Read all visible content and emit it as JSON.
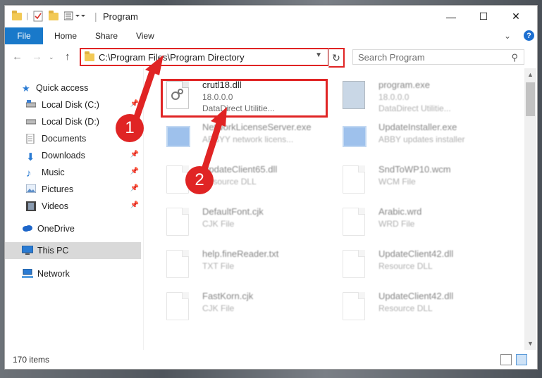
{
  "window": {
    "title": "Program",
    "controls": {
      "minimize": "—",
      "maximize": "☐",
      "close": "✕"
    }
  },
  "ribbon": {
    "file_tab": "File",
    "tabs": [
      "Home",
      "Share",
      "View"
    ],
    "collapse": "⌄",
    "help": "?"
  },
  "address": {
    "path": "C:\\Program Files\\Program Directory",
    "search_placeholder": "Search Program"
  },
  "sidebar": {
    "items": [
      {
        "label": "Quick access",
        "icon": "star-icon"
      },
      {
        "label": "Local Disk (C:)",
        "icon": "drive-icon",
        "pinned": true
      },
      {
        "label": "Local Disk (D:)",
        "icon": "drive-icon"
      },
      {
        "label": "Documents",
        "icon": "documents-icon",
        "pinned": true
      },
      {
        "label": "Downloads",
        "icon": "download-icon",
        "pinned": true
      },
      {
        "label": "Music",
        "icon": "music-icon",
        "pinned": true
      },
      {
        "label": "Pictures",
        "icon": "pictures-icon",
        "pinned": true
      },
      {
        "label": "Videos",
        "icon": "videos-icon",
        "pinned": true
      },
      {
        "label": "OneDrive",
        "icon": "cloud-icon"
      },
      {
        "label": "This PC",
        "icon": "pc-icon",
        "selected": true
      },
      {
        "label": "Network",
        "icon": "network-icon"
      }
    ]
  },
  "files": [
    {
      "name": "crutl18.dll",
      "line2": "18.0.0.0",
      "line3": "DataDirect Utilitie...",
      "icon": "dll-gear-icon"
    },
    {
      "name": "program.exe",
      "line2": "18.0.0.0",
      "line3": "DataDirect Utilitie...",
      "icon": "exe-icon"
    },
    {
      "name": "NetworkLicenseServer.exe",
      "line2": "ABBYY network licens...",
      "icon": "app-window-icon"
    },
    {
      "name": "UpdateInstaller.exe",
      "line2": "ABBY updates installer",
      "icon": "app-window-icon"
    },
    {
      "name": "UpdateClient65.dll",
      "line2": "Resource DLL",
      "icon": "dll-gear-icon"
    },
    {
      "name": "SndToWP10.wcm",
      "line2": "WCM File",
      "icon": "document-icon"
    },
    {
      "name": "DefaultFont.cjk",
      "line2": "CJK File",
      "icon": "document-icon"
    },
    {
      "name": "Arabic.wrd",
      "line2": "WRD File",
      "icon": "document-icon"
    },
    {
      "name": "help.fineReader.txt",
      "line2": "TXT File",
      "icon": "text-file-icon"
    },
    {
      "name": "UpdateClient42.dll",
      "line2": "Resource DLL",
      "icon": "dll-gear-icon"
    },
    {
      "name": "FastKorn.cjk",
      "line2": "CJK File",
      "icon": "document-icon"
    },
    {
      "name": "UpdateClient42.dll",
      "line2": "Resource DLL",
      "icon": "dll-gear-icon"
    }
  ],
  "status": {
    "item_count": "170 items"
  },
  "annotations": {
    "step1": "1",
    "step2": "2",
    "color": "#e02424"
  }
}
